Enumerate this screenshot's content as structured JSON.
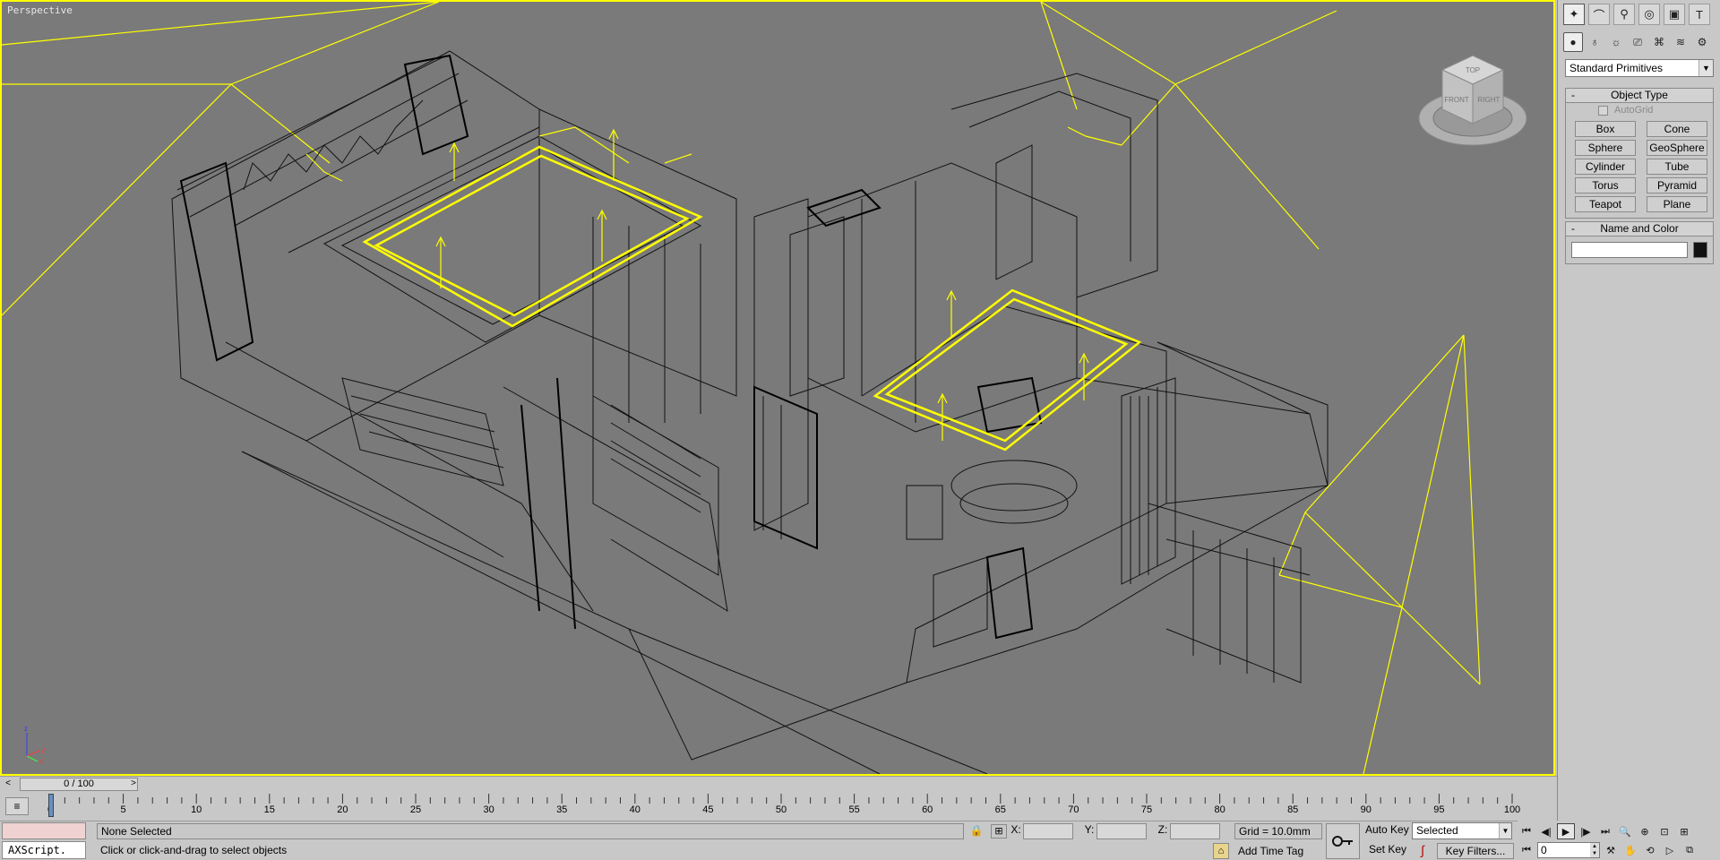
{
  "viewport": {
    "label": "Perspective",
    "border_color": "#ffff00",
    "background_color": "#7a7a7a"
  },
  "viewcube": {
    "top": "TOP",
    "front": "FRONT",
    "right": "RIGHT"
  },
  "axis": {
    "x": "x",
    "y": "y",
    "z": "z"
  },
  "command_panel": {
    "tabs": [
      "create-icon",
      "modify-icon",
      "hierarchy-icon",
      "motion-icon",
      "display-icon",
      "utilities-icon"
    ],
    "subtabs": [
      "geometry-icon",
      "shapes-icon",
      "lights-icon",
      "cameras-icon",
      "helpers-icon",
      "spacewarps-icon",
      "systems-icon"
    ],
    "category": "Standard Primitives",
    "object_type": {
      "title": "Object Type",
      "autogrid": "AutoGrid",
      "buttons": [
        "Box",
        "Cone",
        "Sphere",
        "GeoSphere",
        "Cylinder",
        "Tube",
        "Torus",
        "Pyramid",
        "Teapot",
        "Plane"
      ]
    },
    "name_and_color": {
      "title": "Name and Color",
      "name_value": "",
      "color": "#111111"
    }
  },
  "time_slider": {
    "position": "0 / 100",
    "left_arrow": "<",
    "right_arrow": ">"
  },
  "trackbar": {
    "ticks": [
      "0",
      "5",
      "10",
      "15",
      "20",
      "25",
      "30",
      "35",
      "40",
      "45",
      "50",
      "55",
      "60",
      "65",
      "70",
      "75",
      "80",
      "85",
      "90",
      "95",
      "100"
    ]
  },
  "status": {
    "maxscript": "AXScript.",
    "selection": "None Selected",
    "prompt": "Click or click-and-drag to select objects",
    "x_label": "X:",
    "y_label": "Y:",
    "z_label": "Z:",
    "x_value": "",
    "y_value": "",
    "z_value": "",
    "grid": "Grid = 10.0mm",
    "add_time_tag": "Add Time Tag"
  },
  "animation": {
    "auto_key": "Auto Key",
    "set_key": "Set Key",
    "selected": "Selected",
    "key_filters": "Key Filters...",
    "current_frame": "0"
  }
}
